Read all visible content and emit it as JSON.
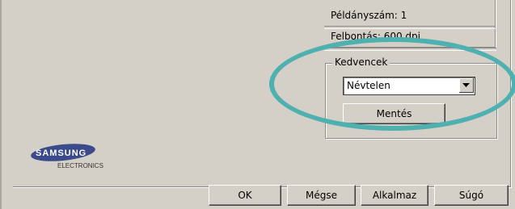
{
  "info": {
    "copies": "Példányszám: 1",
    "resolution": "Felbontás: 600 dpi"
  },
  "favorites": {
    "group_label": "Kedvencek",
    "selected": "Névtelen",
    "save_label": "Mentés"
  },
  "logo": {
    "brand": "SAMSUNG",
    "sub": "ELECTRONICS"
  },
  "buttons": {
    "ok": "OK",
    "cancel": "Mégse",
    "apply": "Alkalmaz",
    "help": "Súgó"
  },
  "colors": {
    "background": "#d4d0c8",
    "highlight_oval": "#4fb0b0"
  },
  "icons": {
    "dropdown": "chevron-down-icon"
  }
}
